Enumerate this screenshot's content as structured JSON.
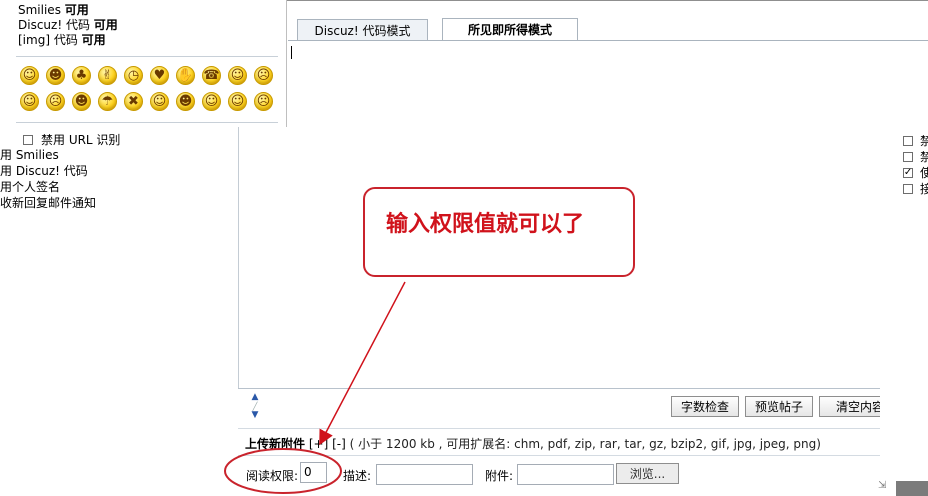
{
  "status": {
    "smilies": {
      "name": "Smilies",
      "state": "可用"
    },
    "discuz_code": {
      "name": "Discuz! 代码",
      "state": "可用"
    },
    "img_code": {
      "name": "[img] 代码",
      "state": "可用"
    }
  },
  "smilies": [
    "smile-icon",
    "grin-icon",
    "waving-man-icon",
    "victory-hand-icon",
    "clock-icon",
    "lips-icon",
    "handshake-icon",
    "phone-icon",
    "wink-smile-icon",
    "angry-icon",
    "tongue-icon",
    "sad-icon",
    "laugh-icon",
    "cry-icon",
    "shout-icon",
    "surprised-icon",
    "tongue-wink-icon",
    "blush-icon",
    "thinking-icon",
    "sick-icon"
  ],
  "options": {
    "disable_url": "禁用 URL 识别",
    "disable_smilies": "禁用 Smilies",
    "disable_discuz": "禁用 Discuz! 代码",
    "use_signature": "使用个人签名",
    "email_notify": "接收新回复邮件通知"
  },
  "tabs": [
    {
      "label": "Discuz! 代码模式",
      "active": false
    },
    {
      "label": "所见即所得模式",
      "active": true
    }
  ],
  "editor": {
    "buttons": {
      "word_count": "字数检查",
      "preview": "预览帖子",
      "clear": "清空内容"
    }
  },
  "upload": {
    "title": "上传新附件",
    "plus": "[+]",
    "minus": "[-]",
    "info": "( 小于 1200 kb , 可用扩展名: chm, pdf, zip, rar, tar, gz, bzip2, gif, jpg, jpeg, png)",
    "read_perm_label": "阅读权限:",
    "read_perm_value": "0",
    "desc_label": "描述:",
    "attach_label": "附件:",
    "browse_label": "浏览..."
  },
  "right_options": [
    {
      "label": "禁",
      "checked": false
    },
    {
      "label": "禁",
      "checked": false
    },
    {
      "label": "使",
      "checked": true
    },
    {
      "label": "接",
      "checked": false
    }
  ],
  "annotation": {
    "text": "输入权限值就可以了",
    "color": "#d0121b"
  },
  "colors": {
    "smiley_yellow": "#ffd21a",
    "annotation_red": "#d0121b",
    "tab_border": "#aab4be"
  }
}
